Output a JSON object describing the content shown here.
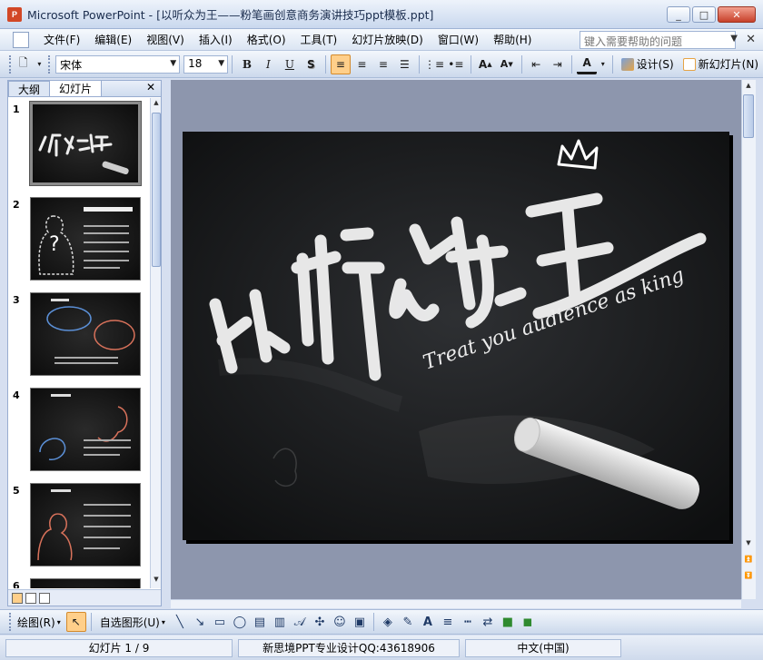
{
  "window": {
    "title": "Microsoft PowerPoint - [以听众为王——粉笔画创意商务演讲技巧ppt模板.ppt]",
    "app_icon_label": "P",
    "minimize": "_",
    "maximize": "□",
    "close": "✕"
  },
  "menu": {
    "items": [
      "文件(F)",
      "编辑(E)",
      "视图(V)",
      "插入(I)",
      "格式(O)",
      "工具(T)",
      "幻灯片放映(D)",
      "窗口(W)",
      "帮助(H)"
    ],
    "help_placeholder": "键入需要帮助的问题",
    "doc_close": "✕"
  },
  "toolbar": {
    "font": "宋体",
    "font_size": "18",
    "bold": "B",
    "italic": "I",
    "underline": "U",
    "shadow": "S",
    "design_label": "设计(S)",
    "new_slide_label": "新幻灯片(N)"
  },
  "left_pane": {
    "tabs": [
      "大纲",
      "幻灯片"
    ],
    "close": "✕",
    "slides": [
      {
        "num": "1"
      },
      {
        "num": "2"
      },
      {
        "num": "3"
      },
      {
        "num": "4"
      },
      {
        "num": "5"
      },
      {
        "num": "6"
      }
    ]
  },
  "slide": {
    "title_art": "以听众为王",
    "subtitle": "Treat you audience as king"
  },
  "drawbar": {
    "draw_label": "绘图(R)",
    "autoshapes_label": "自选图形(U)"
  },
  "status": {
    "slide_info": "幻灯片 1 / 9",
    "design_info": "新思境PPT专业设计QQ:43618906",
    "language": "中文(中国)"
  },
  "colors": {
    "accent_orange": "#ffcf8a",
    "titlebar": "#c9d8ee",
    "slide_bg": "#1b1c1e",
    "workspace": "#8d96ad"
  }
}
